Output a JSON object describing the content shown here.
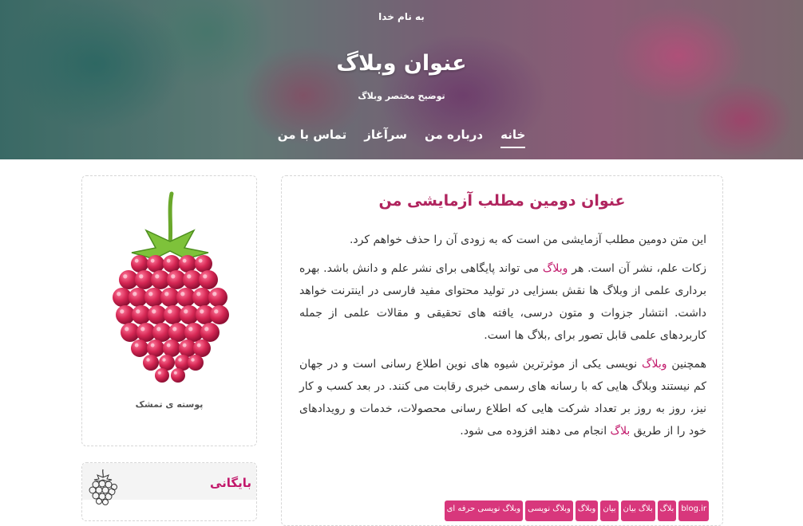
{
  "header": {
    "bismillah": "به نام خدا",
    "title": "عنوان وبلاگ",
    "description": "توضیح مختصر وبلاگ",
    "nav": [
      "خانه",
      "درباره من",
      "سرآغاز",
      "تماس با من"
    ]
  },
  "post": {
    "title": "عنوان دومین مطلب آزمایشی من",
    "paragraphs": [
      [
        {
          "t": "این متن دومین مطلب آزمایشی من است که به زودی آن را حذف خواهم کرد."
        }
      ],
      [
        {
          "t": "زکات علم، نشر آن است. هر "
        },
        {
          "t": "وبلاگ",
          "link": true
        },
        {
          "t": " می تواند پایگاهی برای نشر علم و دانش باشد. بهره برداری علمی از وبلاگ ها نقش بسزایی در تولید محتوای مفید فارسی در اینترنت خواهد داشت. انتشار جزوات و متون درسی، یافته های تحقیقی و مقالات علمی از جمله کاربردهای علمی قابل تصور برای ,بلاگ ها است."
        }
      ],
      [
        {
          "t": "همچنین "
        },
        {
          "t": "وبلاگ",
          "link": true
        },
        {
          "t": " نویسی یکی از موثرترین شیوه های نوین اطلاع رسانی است و در جهان کم نیستند وبلاگ هایی که با رسانه های رسمی خبری رقابت می کنند. در بعد کسب و کار نیز، روز به روز بر تعداد شرکت هایی که اطلاع رسانی محصولات، خدمات و رویدادهای خود را از طریق "
        },
        {
          "t": "بلاگ",
          "link": true
        },
        {
          "t": " انجام می دهند افزوده می شود."
        }
      ]
    ],
    "tags": [
      "blog.ir",
      "بلاگ",
      "بلاگ بیان",
      "بیان",
      "وبلاگ",
      "وبلاگ نویسی",
      "وبلاگ نویسی حرفه ای"
    ]
  },
  "sidebar": {
    "caption": "پوسته ی تمشک",
    "archive_title": "بایگانی"
  },
  "colors": {
    "accent": "#c2186b",
    "tag_bg": "#d8377c",
    "berry": "#d62754"
  }
}
